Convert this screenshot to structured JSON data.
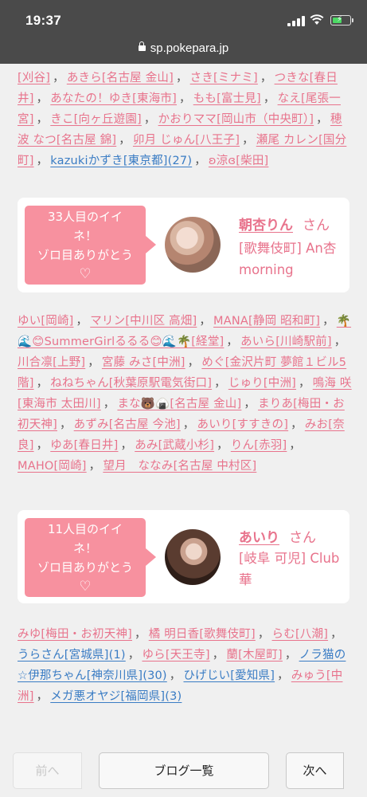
{
  "status": {
    "time": "19:37"
  },
  "browser": {
    "url": "sp.pokepara.jp"
  },
  "names_top": [
    {
      "t": "[刈谷]"
    },
    {
      "t": "あきら[名古屋 金山]"
    },
    {
      "t": "さき[ミナミ]"
    },
    {
      "t": "つきな[春日井]"
    },
    {
      "t": "あなたの！ゆき[東海市]"
    },
    {
      "t": "もも[富士見]"
    },
    {
      "t": "なえ[尾張一宮]"
    },
    {
      "t": "きこ[向ヶ丘遊園]"
    },
    {
      "t": "かおりママ[岡山市（中央町）]"
    },
    {
      "t": "穂波 なつ[名古屋 錦]"
    },
    {
      "t": "卯月 じゅん[八王子]"
    },
    {
      "t": "瀬尾 カレン[国分町]"
    },
    {
      "t": "kazukiかずき[東京都](27)",
      "blue": true
    },
    {
      "t": "ʚ涼ɞ[柴田]"
    }
  ],
  "card1": {
    "bubble_line1": "33人目のイイ",
    "bubble_line2": "ネ！",
    "bubble_line3": "ゾロ目ありがとう",
    "heart": "♡",
    "girl_name": "朝杏りん",
    "honorific": "さん",
    "shop": "[歌舞伎町] An杏morning"
  },
  "names_mid": [
    {
      "t": "ゆい[岡崎]"
    },
    {
      "t": "マリン[中川区 高畑]"
    },
    {
      "t": "MANA[静岡 昭和町]"
    },
    {
      "t": "🌴🌊😊SummerGirlるるる😊🌊🌴[経堂]"
    },
    {
      "t": "あいら[川崎駅前]"
    },
    {
      "t": "川合凛[上野]"
    },
    {
      "t": "宮藤 みさ[中洲]"
    },
    {
      "t": "めぐ[金沢片町 夢館１ビル5階]"
    },
    {
      "t": "ねねちゃん[秋葉原駅電気街口]"
    },
    {
      "t": "じゅり[中洲]"
    },
    {
      "t": "鳴海 咲[東海市 太田川]"
    },
    {
      "t": "まな🐻🍙[名古屋 金山]"
    },
    {
      "t": "まりあ[梅田・お初天神]"
    },
    {
      "t": "あずみ[名古屋 今池]"
    },
    {
      "t": "あいり[すすきの]"
    },
    {
      "t": "みお[奈良]"
    },
    {
      "t": "ゆあ[春日井]"
    },
    {
      "t": "あみ[武蔵小杉]"
    },
    {
      "t": "りん[赤羽]"
    },
    {
      "t": "MAHO[岡崎]"
    },
    {
      "t": "望月　ななみ[名古屋 中村区]"
    }
  ],
  "card2": {
    "bubble_line1": "11人目のイイ",
    "bubble_line2": "ネ！",
    "bubble_line3": "ゾロ目ありがとう",
    "heart": "♡",
    "girl_name": "あいり",
    "honorific": "さん",
    "shop": "[岐阜 可児] Club 華"
  },
  "names_bottom": [
    {
      "t": "みゆ[梅田・お初天神]"
    },
    {
      "t": "橘 明日香[歌舞伎町]"
    },
    {
      "t": "らむ[八潮]"
    },
    {
      "t": "うらさん[宮城県](1)",
      "blue": true
    },
    {
      "t": "ゆら[天王寺]"
    },
    {
      "t": "蘭[木屋町]"
    },
    {
      "t": "ノラ猫の☆伊那ちゃん[神奈川県](30)",
      "blue": true
    },
    {
      "t": "ひげじい[愛知県]",
      "blue": true
    },
    {
      "t": "みゅう[中洲]"
    },
    {
      "t": "メガ悪オヤジ[福岡県](3)",
      "blue": true
    }
  ],
  "nav": {
    "prev": "前へ",
    "list": "ブログ一覧",
    "next": "次へ"
  }
}
